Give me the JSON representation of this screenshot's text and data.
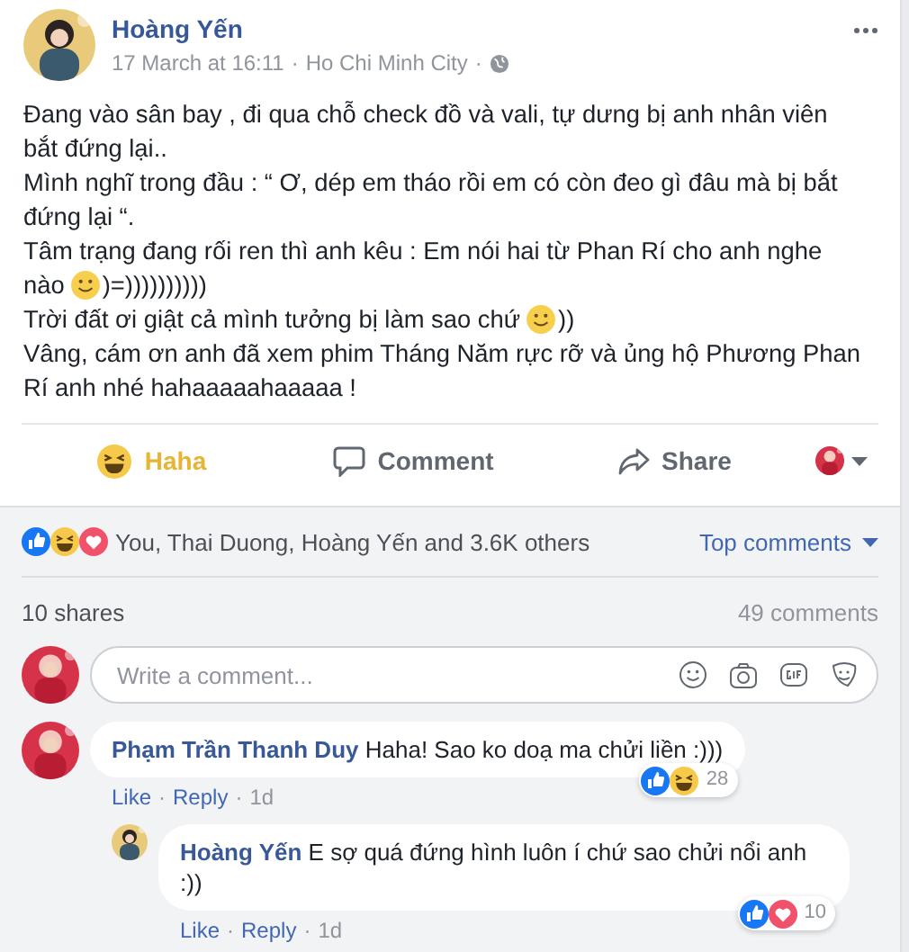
{
  "post": {
    "author": "Hoàng Yến",
    "time": "17 March at 16:11",
    "place": "Ho Chi Minh City",
    "separator": "·",
    "body": [
      [
        {
          "kind": "text",
          "text": "Đang vào sân bay , đi qua chỗ check đồ và vali, tự dưng bị anh nhân viên bắt đứng lại.."
        }
      ],
      [
        {
          "kind": "text",
          "text": "Mình nghĩ trong đầu : “ Ơ, dép em tháo rồi em có còn đeo gì đâu mà bị bắt đứng lại “."
        }
      ],
      [
        {
          "kind": "text",
          "text": "Tâm trạng đang rối ren thì anh kêu : Em nói hai từ Phan Rí cho anh nghe"
        },
        {
          "kind": "text",
          "text": "nào"
        },
        {
          "kind": "emoji"
        },
        {
          "kind": "text",
          "text": ")=))))))))))"
        }
      ],
      [
        {
          "kind": "text",
          "text": "Trời đất ơi giật cả mình tưởng bị làm sao chứ"
        },
        {
          "kind": "emoji"
        },
        {
          "kind": "text",
          "text": "))"
        }
      ],
      [
        {
          "kind": "text",
          "text": "Vâng, cám ơn anh đã xem phim Tháng Năm rực rỡ và ủng hộ Phương Phan Rí anh nhé hahaaaaahaaaaa !"
        }
      ]
    ]
  },
  "actions": [
    {
      "kind": "haha",
      "label": "Haha",
      "selected": true
    },
    {
      "kind": "comment",
      "label": "Comment",
      "selected": false
    },
    {
      "kind": "share",
      "label": "Share",
      "selected": false
    }
  ],
  "summary": {
    "reactions": [
      {
        "kind": "like"
      },
      {
        "kind": "haha"
      },
      {
        "kind": "love"
      }
    ],
    "text": "You, Thai Duong, Hoàng Yến and 3.6K others",
    "sort": "Top comments",
    "shares": "10 shares",
    "comments": "49 comments"
  },
  "composer": {
    "placeholder": "Write a comment..."
  },
  "comments": [
    {
      "author": "Phạm Trần Thanh Duy",
      "text": "Haha! Sao ko doạ ma chửi liền :)))",
      "reactions": [
        {
          "kind": "like"
        },
        {
          "kind": "haha"
        }
      ],
      "count": "28",
      "links": [
        "Like",
        "Reply"
      ],
      "age": "1d",
      "replies": [
        {
          "author": "Hoàng Yến",
          "text": "E sợ quá đứng hình luôn í chứ sao chửi nổi anh :))",
          "reactions": [
            {
              "kind": "like"
            },
            {
              "kind": "love"
            }
          ],
          "count": "10",
          "links": [
            "Like",
            "Reply"
          ],
          "age": "1d"
        }
      ]
    }
  ]
}
